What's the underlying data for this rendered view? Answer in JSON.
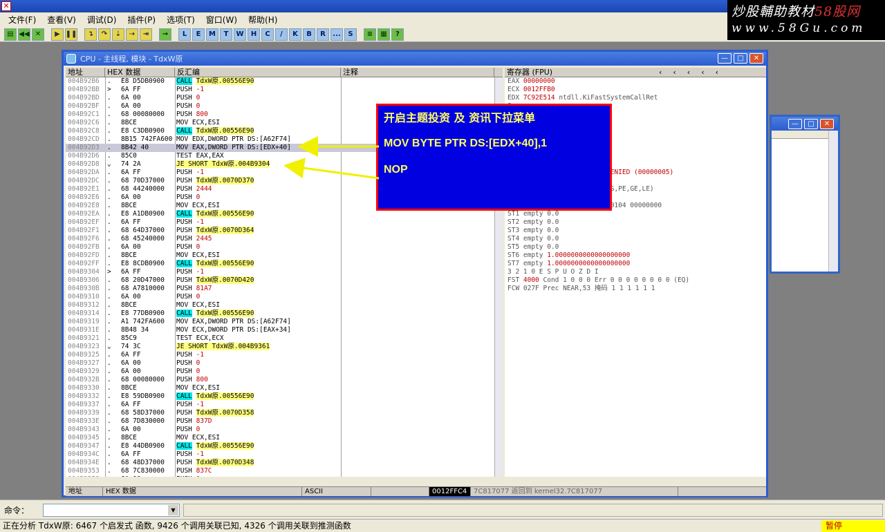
{
  "menu": [
    "文件(F)",
    "查看(V)",
    "调试(D)",
    "插件(P)",
    "选项(T)",
    "窗口(W)",
    "帮助(H)"
  ],
  "toolbar_letters": [
    "L",
    "E",
    "M",
    "T",
    "W",
    "H",
    "C",
    "/",
    "K",
    "B",
    "R",
    "...",
    "S"
  ],
  "watermark": {
    "line1": "炒股輔助教材",
    "line1_red": "58股网",
    "line2": "www.58Gu.com"
  },
  "cpu_window": {
    "title": "CPU - 主线程, 模块 - TdxW原",
    "columns": [
      "地址",
      "HEX 数据",
      "反汇编",
      "注释"
    ],
    "rows": [
      {
        "addr": "004B92B6",
        "mark": ".",
        "hex": "E8 D5DB0900",
        "op": "CALL",
        "arg": "TdxW原.00556E90",
        "style": "call"
      },
      {
        "addr": "004B92BB",
        "mark": ">",
        "hex": "6A FF",
        "op": "PUSH",
        "arg": "-1",
        "style": "push"
      },
      {
        "addr": "004B92BD",
        "mark": ".",
        "hex": "6A 00",
        "op": "PUSH",
        "arg": "0",
        "style": "push"
      },
      {
        "addr": "004B92BF",
        "mark": ".",
        "hex": "6A 00",
        "op": "PUSH",
        "arg": "0",
        "style": "push"
      },
      {
        "addr": "004B92C1",
        "mark": ".",
        "hex": "68 00080000",
        "op": "PUSH",
        "arg": "800",
        "style": "push"
      },
      {
        "addr": "004B92C6",
        "mark": ".",
        "hex": "8BCE",
        "op": "MOV ECX,ESI",
        "arg": "",
        "style": "plain"
      },
      {
        "addr": "004B92C8",
        "mark": ".",
        "hex": "E8 C3DB0900",
        "op": "CALL",
        "arg": "TdxW原.00556E90",
        "style": "call"
      },
      {
        "addr": "004B92CD",
        "mark": ".",
        "hex": "8B15 742FA600",
        "op": "MOV EDX,DWORD PTR DS:[A62F74]",
        "arg": "",
        "style": "plain"
      },
      {
        "addr": "004B92D3",
        "mark": ".",
        "hex": "8B42 40",
        "op": "MOV EAX,DWORD PTR DS:[EDX+40]",
        "arg": "",
        "style": "plain",
        "selected": true
      },
      {
        "addr": "004B92D6",
        "mark": ".",
        "hex": "85C0",
        "op": "TEST EAX,EAX",
        "arg": "",
        "style": "plain"
      },
      {
        "addr": "004B92D8",
        "mark": "⌄",
        "hex": "74 2A",
        "op": "JE SHORT TdxW原.004B9304",
        "arg": "",
        "style": "jmp"
      },
      {
        "addr": "004B92DA",
        "mark": ".",
        "hex": "6A FF",
        "op": "PUSH",
        "arg": "-1",
        "style": "push"
      },
      {
        "addr": "004B92DC",
        "mark": ".",
        "hex": "68 70D37000",
        "op": "PUSH",
        "arg": "TdxW原.0070D370",
        "style": "pushhl"
      },
      {
        "addr": "004B92E1",
        "mark": ".",
        "hex": "68 44240000",
        "op": "PUSH",
        "arg": "2444",
        "style": "push"
      },
      {
        "addr": "004B92E6",
        "mark": ".",
        "hex": "6A 00",
        "op": "PUSH",
        "arg": "0",
        "style": "push"
      },
      {
        "addr": "004B92E8",
        "mark": ".",
        "hex": "8BCE",
        "op": "MOV ECX,ESI",
        "arg": "",
        "style": "plain"
      },
      {
        "addr": "004B92EA",
        "mark": ".",
        "hex": "E8 A1DB0900",
        "op": "CALL",
        "arg": "TdxW原.00556E90",
        "style": "call"
      },
      {
        "addr": "004B92EF",
        "mark": ".",
        "hex": "6A FF",
        "op": "PUSH",
        "arg": "-1",
        "style": "push"
      },
      {
        "addr": "004B92F1",
        "mark": ".",
        "hex": "68 64D37000",
        "op": "PUSH",
        "arg": "TdxW原.0070D364",
        "style": "pushhl"
      },
      {
        "addr": "004B92F6",
        "mark": ".",
        "hex": "68 45240000",
        "op": "PUSH",
        "arg": "2445",
        "style": "push"
      },
      {
        "addr": "004B92FB",
        "mark": ".",
        "hex": "6A 00",
        "op": "PUSH",
        "arg": "0",
        "style": "push"
      },
      {
        "addr": "004B92FD",
        "mark": ".",
        "hex": "8BCE",
        "op": "MOV ECX,ESI",
        "arg": "",
        "style": "plain"
      },
      {
        "addr": "004B92FF",
        "mark": ".",
        "hex": "E8 8CDB0900",
        "op": "CALL",
        "arg": "TdxW原.00556E90",
        "style": "call"
      },
      {
        "addr": "004B9304",
        "mark": ">",
        "hex": "6A FF",
        "op": "PUSH",
        "arg": "-1",
        "style": "push"
      },
      {
        "addr": "004B9306",
        "mark": ".",
        "hex": "68 20D47000",
        "op": "PUSH",
        "arg": "TdxW原.0070D420",
        "style": "pushhl"
      },
      {
        "addr": "004B930B",
        "mark": ".",
        "hex": "68 A7810000",
        "op": "PUSH",
        "arg": "81A7",
        "style": "push"
      },
      {
        "addr": "004B9310",
        "mark": ".",
        "hex": "6A 00",
        "op": "PUSH",
        "arg": "0",
        "style": "push"
      },
      {
        "addr": "004B9312",
        "mark": ".",
        "hex": "8BCE",
        "op": "MOV ECX,ESI",
        "arg": "",
        "style": "plain"
      },
      {
        "addr": "004B9314",
        "mark": ".",
        "hex": "E8 77DB0900",
        "op": "CALL",
        "arg": "TdxW原.00556E90",
        "style": "call"
      },
      {
        "addr": "004B9319",
        "mark": ".",
        "hex": "A1 742FA600",
        "op": "MOV EAX,DWORD PTR DS:[A62F74]",
        "arg": "",
        "style": "plain"
      },
      {
        "addr": "004B931E",
        "mark": ".",
        "hex": "8B48 34",
        "op": "MOV ECX,DWORD PTR DS:[EAX+34]",
        "arg": "",
        "style": "plain"
      },
      {
        "addr": "004B9321",
        "mark": ".",
        "hex": "85C9",
        "op": "TEST ECX,ECX",
        "arg": "",
        "style": "plain"
      },
      {
        "addr": "004B9323",
        "mark": "⌄",
        "hex": "74 3C",
        "op": "JE SHORT TdxW原.004B9361",
        "arg": "",
        "style": "jmp"
      },
      {
        "addr": "004B9325",
        "mark": ".",
        "hex": "6A FF",
        "op": "PUSH",
        "arg": "-1",
        "style": "push"
      },
      {
        "addr": "004B9327",
        "mark": ".",
        "hex": "6A 00",
        "op": "PUSH",
        "arg": "0",
        "style": "push"
      },
      {
        "addr": "004B9329",
        "mark": ".",
        "hex": "6A 00",
        "op": "PUSH",
        "arg": "0",
        "style": "push"
      },
      {
        "addr": "004B932B",
        "mark": ".",
        "hex": "68 00080000",
        "op": "PUSH",
        "arg": "800",
        "style": "push"
      },
      {
        "addr": "004B9330",
        "mark": ".",
        "hex": "8BCE",
        "op": "MOV ECX,ESI",
        "arg": "",
        "style": "plain"
      },
      {
        "addr": "004B9332",
        "mark": ".",
        "hex": "E8 59DB0900",
        "op": "CALL",
        "arg": "TdxW原.00556E90",
        "style": "call"
      },
      {
        "addr": "004B9337",
        "mark": ".",
        "hex": "6A FF",
        "op": "PUSH",
        "arg": "-1",
        "style": "push"
      },
      {
        "addr": "004B9339",
        "mark": ".",
        "hex": "68 58D37000",
        "op": "PUSH",
        "arg": "TdxW原.0070D358",
        "style": "pushhl"
      },
      {
        "addr": "004B933E",
        "mark": ".",
        "hex": "68 7D830000",
        "op": "PUSH",
        "arg": "837D",
        "style": "push"
      },
      {
        "addr": "004B9343",
        "mark": ".",
        "hex": "6A 00",
        "op": "PUSH",
        "arg": "0",
        "style": "push"
      },
      {
        "addr": "004B9345",
        "mark": ".",
        "hex": "8BCE",
        "op": "MOV ECX,ESI",
        "arg": "",
        "style": "plain"
      },
      {
        "addr": "004B9347",
        "mark": ".",
        "hex": "E8 44DB0900",
        "op": "CALL",
        "arg": "TdxW原.00556E90",
        "style": "call"
      },
      {
        "addr": "004B934C",
        "mark": ".",
        "hex": "6A FF",
        "op": "PUSH",
        "arg": "-1",
        "style": "push"
      },
      {
        "addr": "004B934E",
        "mark": ".",
        "hex": "68 48D37000",
        "op": "PUSH",
        "arg": "TdxW原.0070D348",
        "style": "pushhl"
      },
      {
        "addr": "004B9353",
        "mark": ".",
        "hex": "68 7C830000",
        "op": "PUSH",
        "arg": "837C",
        "style": "push"
      },
      {
        "addr": "004B9358",
        "mark": ".",
        "hex": "6A 00",
        "op": "PUSH",
        "arg": "0",
        "style": "push"
      }
    ]
  },
  "registers": {
    "header": "寄存器 (FPU)",
    "lines": [
      {
        "t": "EAX ",
        "v": "00000000",
        "r": ""
      },
      {
        "t": "ECX ",
        "v": "0012FFB0",
        "r": ""
      },
      {
        "t": "EDX ",
        "v": "7C92E514",
        "r": " ntdll.KiFastSystemCallRet"
      },
      {
        "t": "",
        "v": "",
        "r": "8"
      },
      {
        "t": "",
        "v": "",
        "r": "TdxW原.<模块入口点>"
      },
      {
        "t": "",
        "v": "",
        "r": "FFF)"
      },
      {
        "t": "",
        "v": "",
        "r": "FFF)"
      },
      {
        "t": "",
        "v": "",
        "r": "FFF)"
      },
      {
        "t": "",
        "v": "",
        "r": "FFF)"
      },
      {
        "t": "",
        "v": "",
        "r": "(FFFFFFFF)"
      },
      {
        "t": "D 0",
        "v": "",
        "r": ""
      },
      {
        "t": "O 0  LastErr ",
        "v": "ERROR_ACCESS_DENIED (00000005)",
        "r": ""
      },
      {
        "t": "",
        "v": "",
        "r": ""
      },
      {
        "t": "EFL ",
        "v": "00000246",
        "r": " (NO,NB,E,BE,NS,PE,GE,LE)"
      },
      {
        "t": "",
        "v": "",
        "r": ""
      },
      {
        "t": "ST0 empty -UNORM BBB0 01050104 00000000",
        "v": "",
        "r": ""
      },
      {
        "t": "ST1 empty 0.0",
        "v": "",
        "r": ""
      },
      {
        "t": "ST2 empty 0.0",
        "v": "",
        "r": ""
      },
      {
        "t": "ST3 empty 0.0",
        "v": "",
        "r": ""
      },
      {
        "t": "ST4 empty 0.0",
        "v": "",
        "r": ""
      },
      {
        "t": "ST5 empty 0.0",
        "v": "",
        "r": ""
      },
      {
        "t": "ST6 empty ",
        "v": "1.0000000000000000000",
        "r": ""
      },
      {
        "t": "ST7 empty ",
        "v": "1.0000000000000000000",
        "r": ""
      },
      {
        "t": "               3 2 1 0       E S P U O Z D I",
        "v": "",
        "r": ""
      },
      {
        "t": "FST ",
        "v": "4000",
        "r": "  Cond 1 0 0 0  Err 0 0 0 0 0 0 0 0  (EQ)"
      },
      {
        "t": "FCW 027F  Prec NEAR,53  掩码    1 1 1 1 1 1",
        "v": "",
        "r": ""
      }
    ]
  },
  "dump_bar": [
    "地址",
    "HEX 数据",
    "ASCII",
    "",
    "0012FFC4",
    "7C817077 返回到 kernel32.7C817077"
  ],
  "overlay": {
    "title": "开启主题投资 及 资讯下拉菜单",
    "patch": "MOV BYTE PTR DS:[EDX+40],1",
    "nop": "NOP"
  },
  "command": {
    "label": "命令：",
    "value": ""
  },
  "status": {
    "text": "正在分析 TdxW原: 6467 个启发式 函数, 9426 个调用关联已知, 4326 个调用关联到推测函数",
    "state": "暂停"
  },
  "colors": {
    "call_bg": "#00e8e8",
    "jmp_bg": "#ffff80",
    "overlay_bg": "#0000e0",
    "overlay_border": "#ff0000",
    "overlay_text": "#ffff60",
    "arrow": "#f0f000"
  }
}
